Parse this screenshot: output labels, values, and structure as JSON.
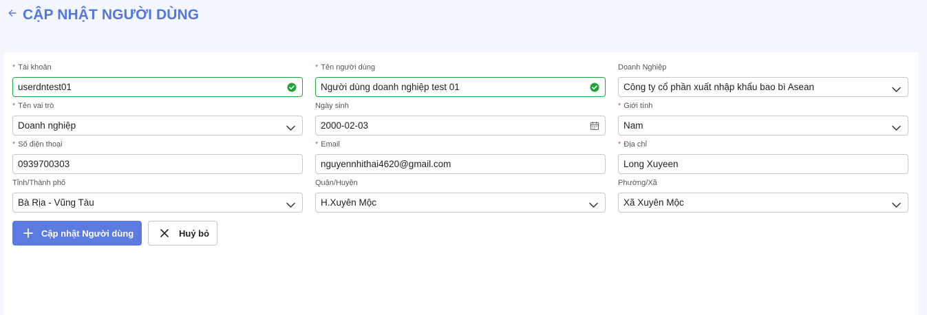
{
  "header": {
    "title": "CẬP NHẬT NGƯỜI DÙNG",
    "back_icon": "arrow-left-icon"
  },
  "colors": {
    "accent": "#5b7be0",
    "valid": "#20a33a",
    "required": "#e5484d",
    "page_bg": "#f3f6fd"
  },
  "form": {
    "account": {
      "label": "Tài khoản",
      "required": true,
      "value": "userdntest01",
      "state": "valid"
    },
    "full_name": {
      "label": "Tên người dùng",
      "required": true,
      "value": "Người dùng doanh nghiệp test 01",
      "state": "valid"
    },
    "company": {
      "label": "Doanh Nghiệp",
      "required": false,
      "value": "Công ty cổ phần xuất nhập khẩu bao bì Asean"
    },
    "role": {
      "label": "Tên vai trò",
      "required": true,
      "value": "Doanh nghiệp"
    },
    "birthday": {
      "label": "Ngày sinh",
      "required": false,
      "value": "2000-02-03"
    },
    "gender": {
      "label": "Giới tính",
      "required": true,
      "value": "Nam"
    },
    "phone": {
      "label": "Số điện thoại",
      "required": true,
      "value": "0939700303"
    },
    "email": {
      "label": "Email",
      "required": true,
      "value": "nguyennhithai4620@gmail.com"
    },
    "address": {
      "label": "Địa chỉ",
      "required": true,
      "value": "Long Xuyeen"
    },
    "province": {
      "label": "Tỉnh/Thành phố",
      "required": false,
      "value": "Bà Rịa - Vũng Tàu"
    },
    "district": {
      "label": "Quận/Huyện",
      "required": false,
      "value": "H.Xuyên Mộc"
    },
    "ward": {
      "label": "Phường/Xã",
      "required": false,
      "value": "Xã Xuyên Mộc"
    }
  },
  "actions": {
    "submit_label": "Cập nhật Người dùng",
    "cancel_label": "Huỷ bỏ"
  }
}
